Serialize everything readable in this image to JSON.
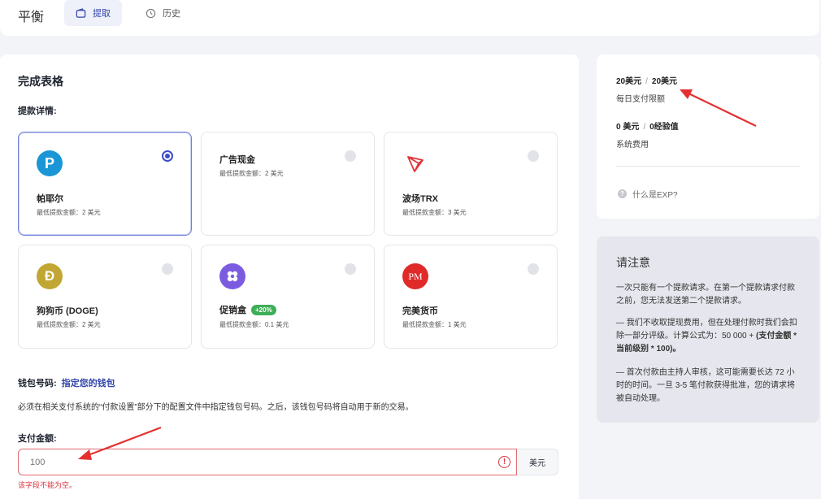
{
  "topbar": {
    "brand": "平衡",
    "tabs": [
      {
        "label": "提取",
        "icon": "wallet-icon"
      },
      {
        "label": "历史",
        "icon": "history-icon"
      }
    ]
  },
  "form": {
    "title": "完成表格",
    "details_label": "提款详情:",
    "options": [
      {
        "name": "帕耶尔",
        "min": "最低提款金额：2 美元",
        "icon": "paypal-icon",
        "color": "#1a96d6",
        "selected": true
      },
      {
        "name": "广告现金",
        "min": "最低提款金额：2 美元",
        "icon": "",
        "color": "",
        "selected": false
      },
      {
        "name": "波场TRX",
        "min": "最低提款金额：3 美元",
        "icon": "tron-icon",
        "color": "#e0353b",
        "selected": false
      },
      {
        "name": "狗狗币 (DOGE)",
        "min": "最低提款金额：2 美元",
        "icon": "dogecoin-icon",
        "color": "#c2a633",
        "selected": false
      },
      {
        "name": "促销盒",
        "min": "最低提款金额：0.1 美元",
        "icon": "promo-box-icon",
        "color": "#7b5ce0",
        "badge": "+20%",
        "selected": false
      },
      {
        "name": "完美货币",
        "min": "最低提款金额：1 美元",
        "icon": "perfect-money-icon",
        "color": "#e02a2a",
        "selected": false
      }
    ],
    "wallet_label": "钱包号码:",
    "wallet_link": "指定您的钱包",
    "wallet_note": "必须在相关支付系统的“付款设置”部分下的配置文件中指定钱包号码。之后，该钱包号码将自动用于新的交易。",
    "amount_label": "支付金额:",
    "amount_placeholder": "100",
    "amount_unit": "美元",
    "amount_error": "该字段不能为空。"
  },
  "limits": {
    "daily_used": "20美元",
    "daily_total": "20美元",
    "daily_label": "每日支付限额",
    "fee_usd": "0 美元",
    "fee_exp": "0经验值",
    "fee_label": "系统费用",
    "exp_link": "什么是EXP?"
  },
  "notice": {
    "title": "请注意",
    "p1": "一次只能有一个提款请求。在第一个提款请求付款之前，您无法发送第二个提款请求。",
    "p2a": "— 我们不收取提现费用，但在处理付款时我们会扣除一部分评级。计算公式为：50 000 + ",
    "p2b": "(支付金额 * 当前级别 * 100)。",
    "p3": "— 首次付款由主持人审核，这可能需要长达 72 小时的时间。一旦 3-5 笔付款获得批准，您的请求将被自动处理。"
  }
}
